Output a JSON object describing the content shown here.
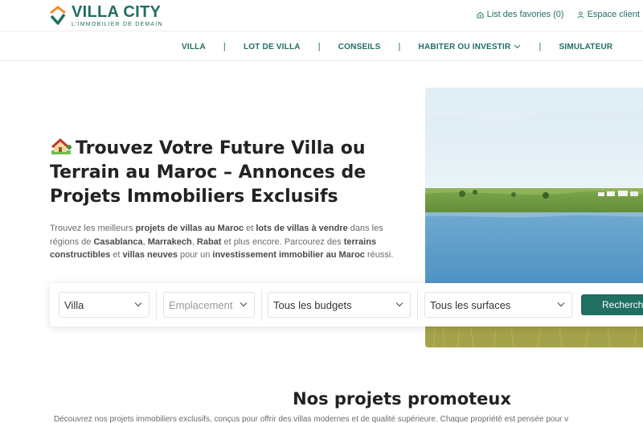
{
  "brand": {
    "title": "VILLA CITY",
    "tagline": "L'IMMOBILIER DE DEMAIN",
    "color_primary": "#1f6f63",
    "color_orange": "#f28a2e"
  },
  "top_links": {
    "favorites": "List des favories (0)",
    "client": "Espace client"
  },
  "nav": {
    "items": [
      "VILLA",
      "LOT DE VILLA",
      "CONSEILS",
      "HABITER OU INVESTIR",
      "SIMULATEUR"
    ],
    "separator": "|"
  },
  "hero": {
    "title": "Trouvez Votre Future Villa ou Terrain au Maroc – Annonces de Projets Immobiliers Exclusifs",
    "desc": {
      "p1": "Trouvez les meilleurs ",
      "b1": "projets de villas au Maroc",
      "p2": " et ",
      "b2": "lots de villas à vendre",
      "p3": " dans les régions de ",
      "b3": "Casablanca",
      "p4": ", ",
      "b4": "Marrakech",
      "p5": ", ",
      "b5": "Rabat",
      "p6": " et plus encore. Parcourez des ",
      "b6": "terrains constructibles",
      "p7": " et ",
      "b7": "villas neuves",
      "p8": " pour un ",
      "b8": "investissement immobilier au Maroc",
      "p9": " réussi."
    }
  },
  "search": {
    "type_value": "Villa",
    "location_placeholder": "Emplacement",
    "budget_value": "Tous les budgets",
    "surface_value": "Tous les surfaces",
    "button": "Rechercher"
  },
  "projects": {
    "title": "Nos projets promoteux",
    "desc": "Découvrez nos projets immobiliers exclusifs, conçus pour offrir des villas modernes et de qualité supérieure. Chaque propriété est pensée pour v"
  }
}
